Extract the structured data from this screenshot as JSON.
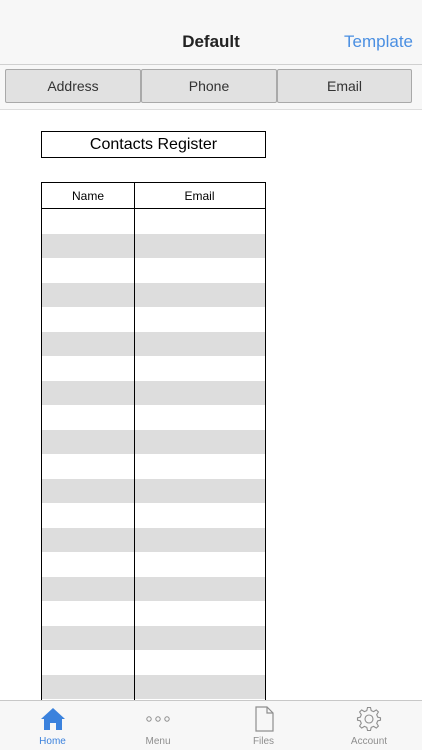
{
  "navbar": {
    "title": "Default",
    "right_action": "Template"
  },
  "segments": [
    {
      "label": "Address"
    },
    {
      "label": "Phone"
    },
    {
      "label": "Email"
    }
  ],
  "sheet": {
    "title": "Contacts Register",
    "columns": [
      "Name",
      "Email"
    ],
    "rows": [
      {
        "name": "",
        "email": ""
      },
      {
        "name": "",
        "email": ""
      },
      {
        "name": "",
        "email": ""
      },
      {
        "name": "",
        "email": ""
      },
      {
        "name": "",
        "email": ""
      },
      {
        "name": "",
        "email": ""
      },
      {
        "name": "",
        "email": ""
      },
      {
        "name": "",
        "email": ""
      },
      {
        "name": "",
        "email": ""
      },
      {
        "name": "",
        "email": ""
      },
      {
        "name": "",
        "email": ""
      },
      {
        "name": "",
        "email": ""
      },
      {
        "name": "",
        "email": ""
      },
      {
        "name": "",
        "email": ""
      },
      {
        "name": "",
        "email": ""
      },
      {
        "name": "",
        "email": ""
      },
      {
        "name": "",
        "email": ""
      },
      {
        "name": "",
        "email": ""
      },
      {
        "name": "",
        "email": ""
      },
      {
        "name": "",
        "email": ""
      },
      {
        "name": "",
        "email": ""
      }
    ]
  },
  "tabbar": {
    "items": [
      {
        "label": "Home",
        "icon": "home-icon",
        "active": true
      },
      {
        "label": "Menu",
        "icon": "more-dots-icon",
        "active": false
      },
      {
        "label": "Files",
        "icon": "file-icon",
        "active": false
      },
      {
        "label": "Account",
        "icon": "gear-icon",
        "active": false
      }
    ]
  },
  "colors": {
    "accent": "#4a8fe2",
    "tab_active": "#3b82dd",
    "tab_inactive": "#8e8e8e",
    "stripe": "#dddddd"
  }
}
